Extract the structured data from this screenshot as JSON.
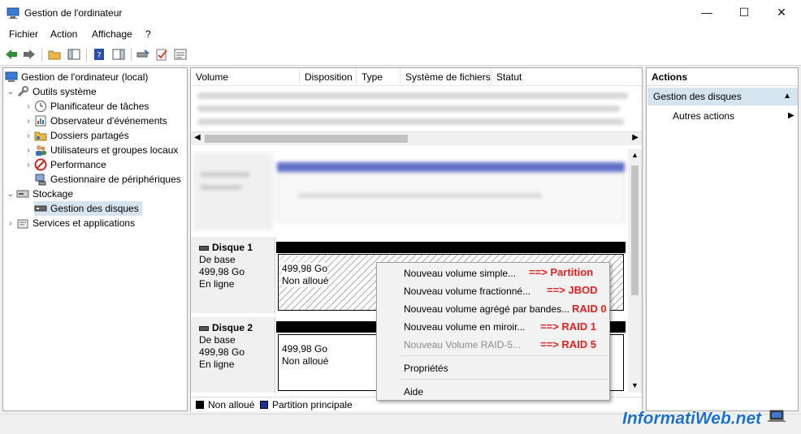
{
  "window": {
    "title": "Gestion de l'ordinateur"
  },
  "menu": [
    "Fichier",
    "Action",
    "Affichage",
    "?"
  ],
  "tree": {
    "root": "Gestion de l'ordinateur (local)",
    "outils": "Outils système",
    "planificateur": "Planificateur de tâches",
    "observateur": "Observateur d'événements",
    "dossiers": "Dossiers partagés",
    "utilisateurs": "Utilisateurs et groupes locaux",
    "performance": "Performance",
    "gestionnaire": "Gestionnaire de périphériques",
    "stockage": "Stockage",
    "gestion_disques": "Gestion des disques",
    "services": "Services et applications"
  },
  "list": {
    "columns": [
      "Volume",
      "Disposition",
      "Type",
      "Système de fichiers",
      "Statut"
    ]
  },
  "disks": [
    {
      "name": "Disque 1",
      "type": "De base",
      "size": "499,98 Go",
      "status": "En ligne",
      "part_size": "499,98 Go",
      "part_state": "Non alloué"
    },
    {
      "name": "Disque 2",
      "type": "De base",
      "size": "499,98 Go",
      "status": "En ligne",
      "part_size": "499,98 Go",
      "part_state": "Non alloué"
    }
  ],
  "legend": {
    "unallocated": "Non alloué",
    "primary": "Partition principale"
  },
  "context_menu": {
    "items": [
      "Nouveau volume simple...",
      "Nouveau volume fractionné...",
      "Nouveau volume agrégé par bandes...",
      "Nouveau volume en miroir...",
      "Nouveau Volume RAID-5...",
      "Propriétés",
      "Aide"
    ],
    "notes": [
      "==> Partition",
      "==> JBOD",
      "RAID 0",
      "==> RAID 1",
      "==> RAID 5"
    ]
  },
  "actions": {
    "title": "Actions",
    "section": "Gestion des disques",
    "other": "Autres actions"
  },
  "watermark": "InformatiWeb.net",
  "colors": {
    "accent_blue": "#1f2f9c",
    "note_red": "#e2201f",
    "selected": "#d6e4f0"
  }
}
